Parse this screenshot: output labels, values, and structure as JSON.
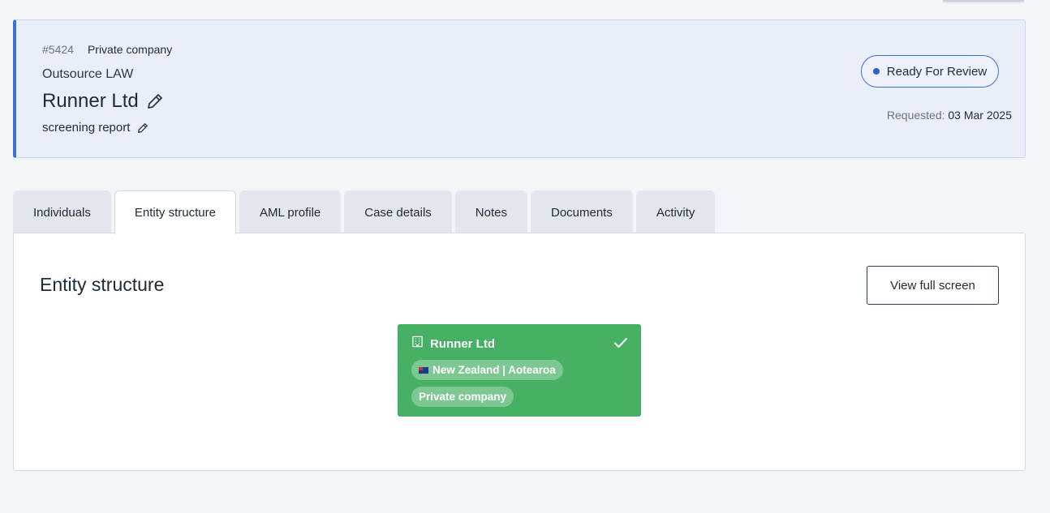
{
  "header": {
    "case_id": "#5424",
    "entity_type": "Private company",
    "org_name": "Outsource LAW",
    "title": "Runner Ltd",
    "subtitle": "screening report",
    "status": "Ready For Review",
    "requested_label": "Requested:",
    "requested_date": "03 Mar 2025"
  },
  "tabs": [
    {
      "label": "Individuals",
      "active": false
    },
    {
      "label": "Entity structure",
      "active": true
    },
    {
      "label": "AML profile",
      "active": false
    },
    {
      "label": "Case details",
      "active": false
    },
    {
      "label": "Notes",
      "active": false
    },
    {
      "label": "Documents",
      "active": false
    },
    {
      "label": "Activity",
      "active": false
    }
  ],
  "panel": {
    "title": "Entity structure",
    "fullscreen_label": "View full screen"
  },
  "node": {
    "name": "Runner Ltd",
    "country": "New Zealand | Aotearoa",
    "type": "Private company",
    "icons": [
      "building-icon",
      "check-icon",
      "nz-flag-icon"
    ],
    "color": "#46b164"
  },
  "colors": {
    "accent": "#3b6fd8",
    "header_bg": "#eaeef9",
    "verified_green": "#46b164"
  }
}
